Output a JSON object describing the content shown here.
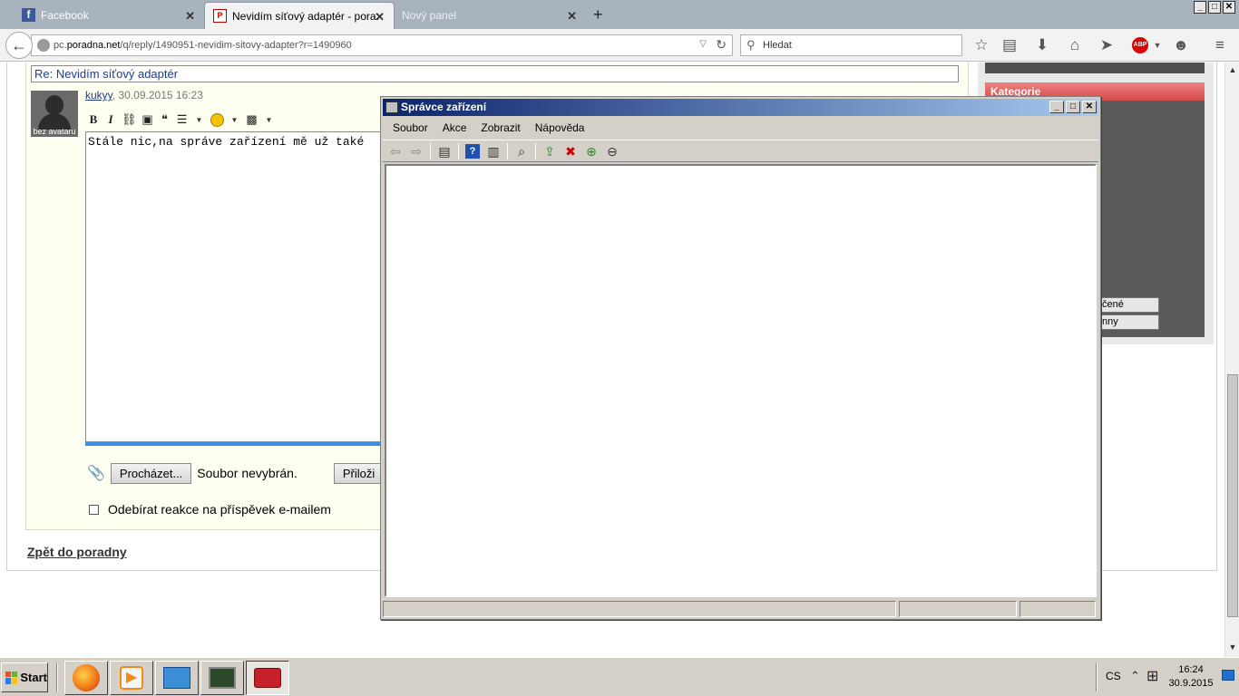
{
  "browser": {
    "tabs": [
      {
        "label": "Facebook",
        "state": "inactive",
        "icon": "facebook-icon"
      },
      {
        "label": "Nevidím síťový adaptér - pora...",
        "state": "active",
        "icon": "poradna-icon"
      },
      {
        "label": "Nový panel",
        "state": "inactive",
        "icon": ""
      }
    ],
    "new_tab": "+",
    "window_controls": {
      "minimize": "_",
      "maximize": "□",
      "close": "✕"
    },
    "url": {
      "prefix": "pc.",
      "domain": "poradna.net",
      "path": "/q/reply/1490951-nevidim-sitovy-adapter?r=1490960"
    },
    "search_placeholder": "Hledat",
    "abp_label": "ABP"
  },
  "page": {
    "reply_title": "Re: Nevidím síťový adaptér",
    "avatar_label": "bez avataru",
    "author": "kukyy",
    "date_sep": ",",
    "date": "30.09.2015 16:23",
    "editor_text": "Stále nic,na správe zařízení mě už také",
    "browse_button": "Procházet...",
    "file_status": "Soubor nevybrán.",
    "attach_button": "Přiloži",
    "subscribe_label": "Odebírat reakce na příspěvek e-mailem",
    "back_link": "Zpět do poradny",
    "sidebar": {
      "category_title": "Kategorie",
      "buttons": [
        "čené",
        "nny"
      ]
    }
  },
  "device_manager": {
    "title": "Správce zařízení",
    "menus": [
      "Soubor",
      "Akce",
      "Zobrazit",
      "Nápověda"
    ]
  },
  "taskbar": {
    "start_label": "Start",
    "lang": "CS",
    "time": "16:24",
    "date": "30.9.2015"
  },
  "colors": {
    "titlebar_start": "#0a246a",
    "titlebar_end": "#a6caf0",
    "category_header": "#e06060",
    "link_blue": "#1a3b9e"
  }
}
